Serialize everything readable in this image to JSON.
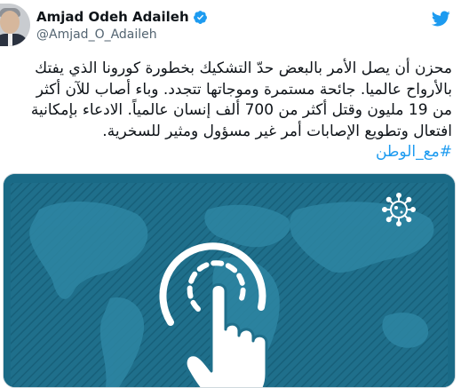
{
  "author": {
    "display_name": "Amjad Odeh Adaileh",
    "handle": "@Amjad_O_Adaileh",
    "verified": true,
    "verified_icon": "verified-badge-icon",
    "brand_icon": "twitter-bird-icon"
  },
  "tweet": {
    "lines": [
      "محزن أن يصل الأمر بالبعض حدّ التشكيك بخطورة كورونا الذي يفتك",
      "بالأرواح عالميا. جائحة مستمرة وموجاتها تتجدد. وباء أصاب للآن أكثر",
      "من 19 مليون وقتل أكثر من 700 ألف إنسان عالمياً. الادعاء بإمكانية",
      "افتعال وتطويع الإصابات أمر غير مسؤول ومثير للسخرية."
    ],
    "hashtag": "#مع_الوطن"
  },
  "media": {
    "description_icons": [
      "virus-icon",
      "tap-hand-icon"
    ],
    "colors": {
      "background": "#1f6f8b",
      "background_dark": "#17607a",
      "map_land": "#2e86a3",
      "icon": "#ffffff"
    }
  },
  "colors": {
    "accent": "#1d9bf0",
    "text": "#0f1419",
    "secondary_text": "#536471"
  }
}
